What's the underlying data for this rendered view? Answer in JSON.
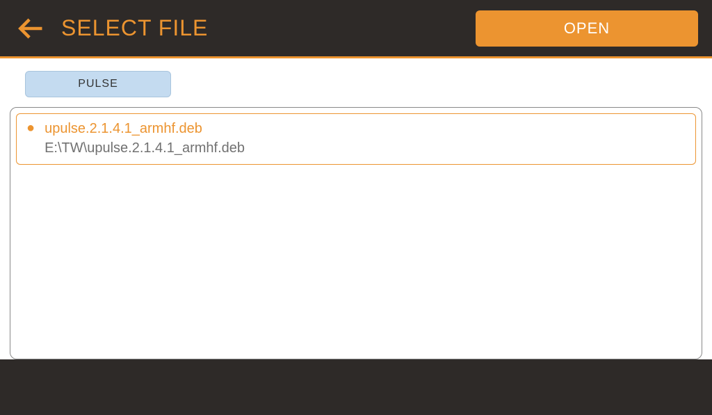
{
  "header": {
    "title": "SELECT FILE",
    "open_label": "OPEN"
  },
  "tabs": {
    "pulse_label": "PULSE"
  },
  "files": [
    {
      "name": "upulse.2.1.4.1_armhf.deb",
      "path": "E:\\TW\\upulse.2.1.4.1_armhf.deb"
    }
  ]
}
